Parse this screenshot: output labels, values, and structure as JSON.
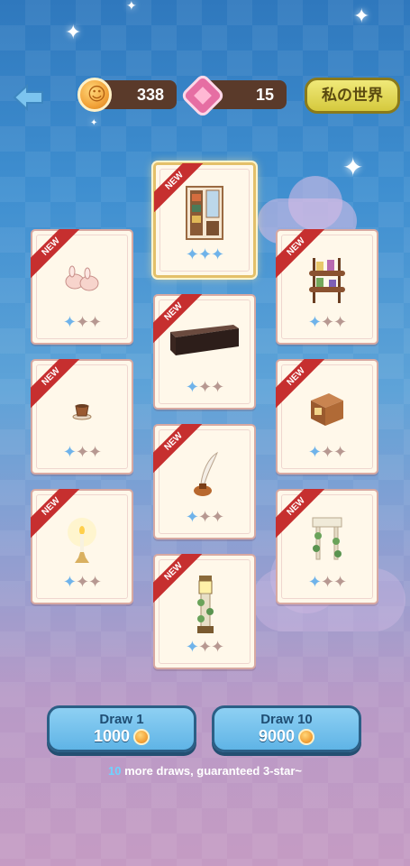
{
  "top_bar": {
    "coins": "338",
    "gems": "15",
    "world_button": "私の世界"
  },
  "cards": [
    {
      "badge": "NEW",
      "item": "bookshelf-window-icon",
      "stars_on": 3,
      "stars_total": 3,
      "special": true
    },
    {
      "badge": "NEW",
      "item": "bunny-slippers-icon",
      "stars_on": 1,
      "stars_total": 3
    },
    {
      "badge": "NEW",
      "item": "dark-bench-icon",
      "stars_on": 1,
      "stars_total": 3
    },
    {
      "badge": "NEW",
      "item": "display-shelf-icon",
      "stars_on": 1,
      "stars_total": 3
    },
    {
      "badge": "NEW",
      "item": "teacup-icon",
      "stars_on": 1,
      "stars_total": 3
    },
    {
      "badge": "NEW",
      "item": "quill-ink-icon",
      "stars_on": 1,
      "stars_total": 3
    },
    {
      "badge": "NEW",
      "item": "wooden-cabinet-icon",
      "stars_on": 1,
      "stars_total": 3
    },
    {
      "badge": "NEW",
      "item": "candle-icon",
      "stars_on": 1,
      "stars_total": 3
    },
    {
      "badge": "NEW",
      "item": "ivy-shelf-icon",
      "stars_on": 1,
      "stars_total": 3
    },
    {
      "badge": "NEW",
      "item": "ivy-lamp-post-icon",
      "stars_on": 1,
      "stars_total": 3
    }
  ],
  "draw": {
    "single_label": "Draw 1",
    "single_cost": "1000",
    "multi_label": "Draw 10",
    "multi_cost": "9000"
  },
  "hint": {
    "count": "10",
    "text": " more draws, guaranteed 3-star~"
  },
  "colors": {
    "accent_star": "#6fb3ea",
    "ribbon": "#c62f2f",
    "button": "#5fb4e6"
  }
}
